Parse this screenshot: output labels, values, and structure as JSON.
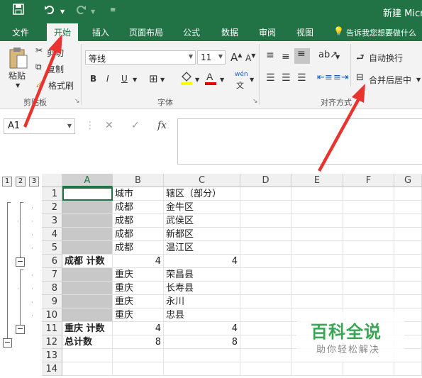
{
  "app": {
    "title": "新建 Micr"
  },
  "quick_access": {
    "save_icon": "save-icon",
    "undo_icon": "undo-icon",
    "redo_icon": "redo-icon",
    "customize_icon": "customize-icon"
  },
  "tabs": [
    "文件",
    "开始",
    "插入",
    "页面布局",
    "公式",
    "数据",
    "审阅",
    "视图"
  ],
  "tell_me": "告诉我您想要做什么",
  "ribbon": {
    "clipboard": {
      "paste": "粘贴",
      "cut": "剪切",
      "copy": "复制",
      "format_painter": "格式刷",
      "group": "剪贴板"
    },
    "font": {
      "name": "等线",
      "size": "11",
      "bold": "B",
      "italic": "I",
      "underline": "U",
      "wen": "wén",
      "group": "字体"
    },
    "alignment": {
      "wrap": "自动换行",
      "merge": "合并后居中",
      "group": "对齐方式"
    }
  },
  "formula_bar": {
    "name_box": "A1",
    "fx": "fx",
    "cancel": "✕",
    "enter": "✓"
  },
  "outline_levels": [
    "1",
    "2",
    "3"
  ],
  "columns": [
    "A",
    "B",
    "C",
    "D",
    "E",
    "F",
    "G"
  ],
  "rows": [
    {
      "num": "1",
      "a": "",
      "b": "城市",
      "c": "辖区（部分）",
      "gray": false,
      "bold": false
    },
    {
      "num": "2",
      "a": "",
      "b": "成都",
      "c": "金牛区",
      "gray": true,
      "bold": false
    },
    {
      "num": "3",
      "a": "",
      "b": "成都",
      "c": "武侯区",
      "gray": true,
      "bold": false
    },
    {
      "num": "4",
      "a": "",
      "b": "成都",
      "c": "新都区",
      "gray": true,
      "bold": false
    },
    {
      "num": "5",
      "a": "",
      "b": "成都",
      "c": "温江区",
      "gray": true,
      "bold": false
    },
    {
      "num": "6",
      "a": "成都 计数",
      "b": "4",
      "c": "4",
      "gray": false,
      "bold": true
    },
    {
      "num": "7",
      "a": "",
      "b": "重庆",
      "c": "荣昌县",
      "gray": true,
      "bold": false
    },
    {
      "num": "8",
      "a": "",
      "b": "重庆",
      "c": "长寿县",
      "gray": true,
      "bold": false
    },
    {
      "num": "9",
      "a": "",
      "b": "重庆",
      "c": "永川",
      "gray": true,
      "bold": false
    },
    {
      "num": "10",
      "a": "",
      "b": "重庆",
      "c": "忠县",
      "gray": true,
      "bold": false
    },
    {
      "num": "11",
      "a": "重庆 计数",
      "b": "4",
      "c": "4",
      "gray": false,
      "bold": true
    },
    {
      "num": "12",
      "a": "总计数",
      "b": "8",
      "c": "8",
      "gray": false,
      "bold": true
    },
    {
      "num": "13",
      "a": "",
      "b": "",
      "c": "",
      "gray": false,
      "bold": false
    },
    {
      "num": "14",
      "a": "",
      "b": "",
      "c": "",
      "gray": false,
      "bold": false
    }
  ],
  "watermark": {
    "title": "百科全说",
    "subtitle": "助你轻松解决"
  },
  "colors": {
    "excel_green": "#217346",
    "arrow_red": "#e8332f",
    "watermark_green": "#3aa655"
  }
}
